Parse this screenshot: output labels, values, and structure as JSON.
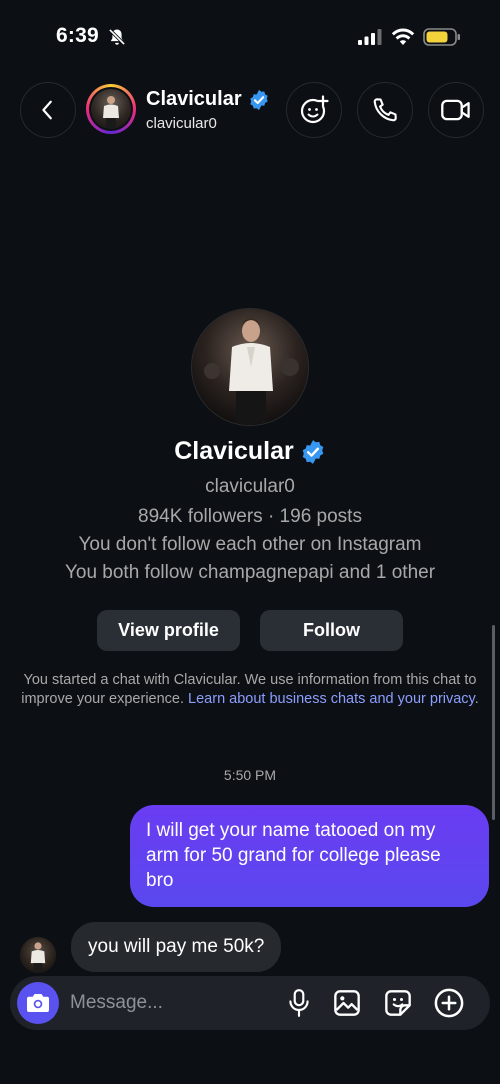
{
  "status_bar": {
    "time": "6:39"
  },
  "header": {
    "name": "Clavicular",
    "username": "clavicular0"
  },
  "profile": {
    "name": "Clavicular",
    "username": "clavicular0",
    "stats": "894K followers · 196 posts",
    "mutual_line1": "You don't follow each other on Instagram",
    "mutual_line2": "You both follow champagnepapi and 1 other",
    "view_profile_label": "View profile",
    "follow_label": "Follow"
  },
  "disclaimer": {
    "text": "You started a chat with Clavicular. We use information from this chat to improve your experience. ",
    "link": "Learn about business chats and your privacy",
    "end": "."
  },
  "conversation": {
    "timestamp": "5:50 PM",
    "messages": [
      {
        "from": "me",
        "text": "I will get your name tatooed on my arm for 50 grand for college please bro"
      },
      {
        "from": "them",
        "text": "you will pay me 50k?"
      }
    ]
  },
  "composer": {
    "placeholder": "Message..."
  },
  "colors": {
    "background": "#0c1014",
    "sent_bubble": "#5a48ee",
    "received_bubble": "#262a2f",
    "verified": "#3897f0",
    "link": "#8c9eff"
  },
  "icons": [
    "bell-slash-icon",
    "signal-icon",
    "wifi-icon",
    "battery-icon",
    "back-chevron-icon",
    "verified-badge-icon",
    "effects-icon",
    "phone-icon",
    "video-camera-icon",
    "camera-icon",
    "microphone-icon",
    "gallery-icon",
    "sticker-icon",
    "plus-icon"
  ]
}
